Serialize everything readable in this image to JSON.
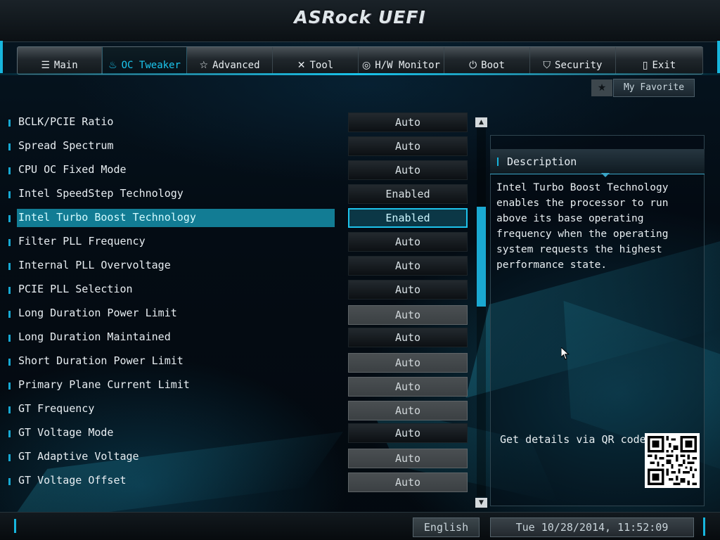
{
  "header": {
    "logo": "ASRock UEFI"
  },
  "tabs": [
    {
      "label": "Main",
      "icon": "list-icon",
      "glyph": "☰"
    },
    {
      "label": "OC Tweaker",
      "icon": "flame-icon",
      "glyph": "♨",
      "active": true
    },
    {
      "label": "Advanced",
      "icon": "star-icon",
      "glyph": "☆"
    },
    {
      "label": "Tool",
      "icon": "tools-icon",
      "glyph": "✕"
    },
    {
      "label": "H/W Monitor",
      "icon": "monitor-icon",
      "glyph": "◎"
    },
    {
      "label": "Boot",
      "icon": "power-icon",
      "glyph": "⏻"
    },
    {
      "label": "Security",
      "icon": "shield-icon",
      "glyph": "⛉"
    },
    {
      "label": "Exit",
      "icon": "exit-door-icon",
      "glyph": "▯"
    }
  ],
  "favorite": {
    "label": "My Favorite",
    "star_glyph": "★"
  },
  "settings": [
    {
      "label": "BCLK/PCIE Ratio",
      "value": "Auto",
      "style": "dark"
    },
    {
      "label": "Spread Spectrum",
      "value": "Auto",
      "style": "dark"
    },
    {
      "label": "CPU OC Fixed Mode",
      "value": "Auto",
      "style": "dark"
    },
    {
      "label": "Intel SpeedStep Technology",
      "value": "Enabled",
      "style": "dark"
    },
    {
      "label": "Intel Turbo Boost Technology",
      "value": "Enabled",
      "style": "selected"
    },
    {
      "label": "Filter PLL Frequency",
      "value": "Auto",
      "style": "dark"
    },
    {
      "label": "Internal PLL Overvoltage",
      "value": "Auto",
      "style": "dark"
    },
    {
      "label": "PCIE PLL Selection",
      "value": "Auto",
      "style": "dark"
    },
    {
      "label": "Long Duration Power Limit",
      "value": "Auto",
      "style": "gray"
    },
    {
      "label": "Long Duration Maintained",
      "value": "Auto",
      "style": "dark"
    },
    {
      "label": "Short Duration Power Limit",
      "value": "Auto",
      "style": "gray"
    },
    {
      "label": "Primary Plane Current Limit",
      "value": "Auto",
      "style": "gray"
    },
    {
      "label": "GT Frequency",
      "value": "Auto",
      "style": "gray"
    },
    {
      "label": "GT Voltage Mode",
      "value": "Auto",
      "style": "dark"
    },
    {
      "label": "GT Adaptive Voltage",
      "value": "Auto",
      "style": "gray"
    },
    {
      "label": "GT Voltage Offset",
      "value": "Auto",
      "style": "gray"
    }
  ],
  "scrollbar": {
    "up_glyph": "▲",
    "down_glyph": "▼"
  },
  "description": {
    "title": "Description",
    "text": "Intel Turbo Boost Technology enables the processor to run above its base operating frequency  when the operating system requests the highest performance state.",
    "qr_label": "Get details via QR code"
  },
  "footer": {
    "language": "English",
    "datetime": "Tue 10/28/2014, 11:52:09"
  },
  "colors": {
    "accent": "#17b6de",
    "selected_row": "#127c94"
  }
}
